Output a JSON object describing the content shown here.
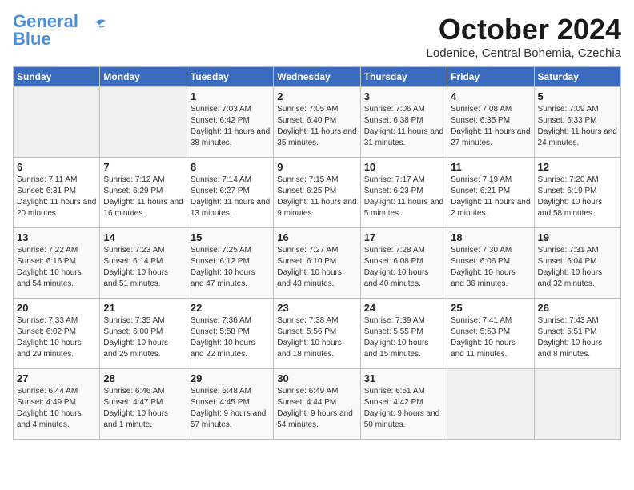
{
  "header": {
    "logo_line1": "General",
    "logo_line2": "Blue",
    "month": "October 2024",
    "location": "Lodenice, Central Bohemia, Czechia"
  },
  "days_of_week": [
    "Sunday",
    "Monday",
    "Tuesday",
    "Wednesday",
    "Thursday",
    "Friday",
    "Saturday"
  ],
  "weeks": [
    [
      {
        "day": "",
        "empty": true
      },
      {
        "day": "",
        "empty": true
      },
      {
        "day": "1",
        "sunrise": "Sunrise: 7:03 AM",
        "sunset": "Sunset: 6:42 PM",
        "daylight": "Daylight: 11 hours and 38 minutes."
      },
      {
        "day": "2",
        "sunrise": "Sunrise: 7:05 AM",
        "sunset": "Sunset: 6:40 PM",
        "daylight": "Daylight: 11 hours and 35 minutes."
      },
      {
        "day": "3",
        "sunrise": "Sunrise: 7:06 AM",
        "sunset": "Sunset: 6:38 PM",
        "daylight": "Daylight: 11 hours and 31 minutes."
      },
      {
        "day": "4",
        "sunrise": "Sunrise: 7:08 AM",
        "sunset": "Sunset: 6:35 PM",
        "daylight": "Daylight: 11 hours and 27 minutes."
      },
      {
        "day": "5",
        "sunrise": "Sunrise: 7:09 AM",
        "sunset": "Sunset: 6:33 PM",
        "daylight": "Daylight: 11 hours and 24 minutes."
      }
    ],
    [
      {
        "day": "6",
        "sunrise": "Sunrise: 7:11 AM",
        "sunset": "Sunset: 6:31 PM",
        "daylight": "Daylight: 11 hours and 20 minutes."
      },
      {
        "day": "7",
        "sunrise": "Sunrise: 7:12 AM",
        "sunset": "Sunset: 6:29 PM",
        "daylight": "Daylight: 11 hours and 16 minutes."
      },
      {
        "day": "8",
        "sunrise": "Sunrise: 7:14 AM",
        "sunset": "Sunset: 6:27 PM",
        "daylight": "Daylight: 11 hours and 13 minutes."
      },
      {
        "day": "9",
        "sunrise": "Sunrise: 7:15 AM",
        "sunset": "Sunset: 6:25 PM",
        "daylight": "Daylight: 11 hours and 9 minutes."
      },
      {
        "day": "10",
        "sunrise": "Sunrise: 7:17 AM",
        "sunset": "Sunset: 6:23 PM",
        "daylight": "Daylight: 11 hours and 5 minutes."
      },
      {
        "day": "11",
        "sunrise": "Sunrise: 7:19 AM",
        "sunset": "Sunset: 6:21 PM",
        "daylight": "Daylight: 11 hours and 2 minutes."
      },
      {
        "day": "12",
        "sunrise": "Sunrise: 7:20 AM",
        "sunset": "Sunset: 6:19 PM",
        "daylight": "Daylight: 10 hours and 58 minutes."
      }
    ],
    [
      {
        "day": "13",
        "sunrise": "Sunrise: 7:22 AM",
        "sunset": "Sunset: 6:16 PM",
        "daylight": "Daylight: 10 hours and 54 minutes."
      },
      {
        "day": "14",
        "sunrise": "Sunrise: 7:23 AM",
        "sunset": "Sunset: 6:14 PM",
        "daylight": "Daylight: 10 hours and 51 minutes."
      },
      {
        "day": "15",
        "sunrise": "Sunrise: 7:25 AM",
        "sunset": "Sunset: 6:12 PM",
        "daylight": "Daylight: 10 hours and 47 minutes."
      },
      {
        "day": "16",
        "sunrise": "Sunrise: 7:27 AM",
        "sunset": "Sunset: 6:10 PM",
        "daylight": "Daylight: 10 hours and 43 minutes."
      },
      {
        "day": "17",
        "sunrise": "Sunrise: 7:28 AM",
        "sunset": "Sunset: 6:08 PM",
        "daylight": "Daylight: 10 hours and 40 minutes."
      },
      {
        "day": "18",
        "sunrise": "Sunrise: 7:30 AM",
        "sunset": "Sunset: 6:06 PM",
        "daylight": "Daylight: 10 hours and 36 minutes."
      },
      {
        "day": "19",
        "sunrise": "Sunrise: 7:31 AM",
        "sunset": "Sunset: 6:04 PM",
        "daylight": "Daylight: 10 hours and 32 minutes."
      }
    ],
    [
      {
        "day": "20",
        "sunrise": "Sunrise: 7:33 AM",
        "sunset": "Sunset: 6:02 PM",
        "daylight": "Daylight: 10 hours and 29 minutes."
      },
      {
        "day": "21",
        "sunrise": "Sunrise: 7:35 AM",
        "sunset": "Sunset: 6:00 PM",
        "daylight": "Daylight: 10 hours and 25 minutes."
      },
      {
        "day": "22",
        "sunrise": "Sunrise: 7:36 AM",
        "sunset": "Sunset: 5:58 PM",
        "daylight": "Daylight: 10 hours and 22 minutes."
      },
      {
        "day": "23",
        "sunrise": "Sunrise: 7:38 AM",
        "sunset": "Sunset: 5:56 PM",
        "daylight": "Daylight: 10 hours and 18 minutes."
      },
      {
        "day": "24",
        "sunrise": "Sunrise: 7:39 AM",
        "sunset": "Sunset: 5:55 PM",
        "daylight": "Daylight: 10 hours and 15 minutes."
      },
      {
        "day": "25",
        "sunrise": "Sunrise: 7:41 AM",
        "sunset": "Sunset: 5:53 PM",
        "daylight": "Daylight: 10 hours and 11 minutes."
      },
      {
        "day": "26",
        "sunrise": "Sunrise: 7:43 AM",
        "sunset": "Sunset: 5:51 PM",
        "daylight": "Daylight: 10 hours and 8 minutes."
      }
    ],
    [
      {
        "day": "27",
        "sunrise": "Sunrise: 6:44 AM",
        "sunset": "Sunset: 4:49 PM",
        "daylight": "Daylight: 10 hours and 4 minutes."
      },
      {
        "day": "28",
        "sunrise": "Sunrise: 6:46 AM",
        "sunset": "Sunset: 4:47 PM",
        "daylight": "Daylight: 10 hours and 1 minute."
      },
      {
        "day": "29",
        "sunrise": "Sunrise: 6:48 AM",
        "sunset": "Sunset: 4:45 PM",
        "daylight": "Daylight: 9 hours and 57 minutes."
      },
      {
        "day": "30",
        "sunrise": "Sunrise: 6:49 AM",
        "sunset": "Sunset: 4:44 PM",
        "daylight": "Daylight: 9 hours and 54 minutes."
      },
      {
        "day": "31",
        "sunrise": "Sunrise: 6:51 AM",
        "sunset": "Sunset: 4:42 PM",
        "daylight": "Daylight: 9 hours and 50 minutes."
      },
      {
        "day": "",
        "empty": true
      },
      {
        "day": "",
        "empty": true
      }
    ]
  ]
}
